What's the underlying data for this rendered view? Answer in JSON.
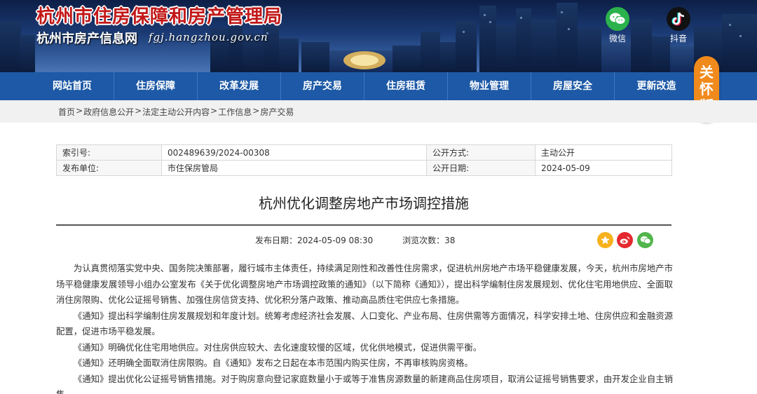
{
  "header": {
    "title": "杭州市住房保障和房产管理局",
    "subtitle": "杭州市房产信息网",
    "url": "fgj.hangzhou.gov.cn",
    "social": [
      {
        "label": "微信",
        "icon": "wechat-icon"
      },
      {
        "label": "抖音",
        "icon": "douyin-icon"
      }
    ]
  },
  "nav": {
    "items": [
      "网站首页",
      "住房保障",
      "改革发展",
      "房产交易",
      "住房租赁",
      "物业管理",
      "房屋安全",
      "更新改造"
    ]
  },
  "care_mode": {
    "chars": [
      "关",
      "怀",
      "版"
    ]
  },
  "breadcrumb": [
    "首页",
    "政府信息公开",
    "法定主动公开内容",
    "工作信息",
    "房产交易"
  ],
  "meta": {
    "index_label": "索引号:",
    "index_value": "002489639/2024-00308",
    "method_label": "公开方式:",
    "method_value": "主动公开",
    "unit_label": "发布单位:",
    "unit_value": "市住保房管局",
    "date_label": "公开日期:",
    "date_value": "2024-05-09"
  },
  "article": {
    "title": "杭州优化调整房地产市场调控措施",
    "publish": "发布日期：2024-05-09 08:30",
    "views": "浏览次数：38",
    "paragraphs": [
      "为认真贯彻落实党中央、国务院决策部署，履行城市主体责任，持续满足刚性和改善性住房需求，促进杭州房地产市场平稳健康发展，今天，杭州市房地产市场平稳健康发展领导小组办公室发布《关于优化调整房地产市场调控政策的通知》（以下简称《通知》），提出科学编制住房发展规划、优化住宅用地供应、全面取消住房限购、优化公证摇号销售、加强住房信贷支持、优化积分落户政策、推动高品质住宅供应七条措施。",
      "《通知》提出科学编制住房发展规划和年度计划。统筹考虑经济社会发展、人口变化、产业布局、住房供需等方面情况，科学安排土地、住房供应和金融资源配置，促进市场平稳发展。",
      "《通知》明确优化住宅用地供应。对住房供应较大、去化速度较慢的区域，优化供地模式，促进供需平衡。",
      "《通知》还明确全面取消住房限购。自《通知》发布之日起在本市范围内购买住房，不再审核购房资格。",
      "《通知》提出优化公证摇号销售措施。对于购房意向登记家庭数量小于或等于准售房源数量的新建商品住房项目，取消公证摇号销售要求，由开发企业自主销售。"
    ]
  },
  "colors": {
    "nav_bg": "#1d59a6",
    "title_red": "#c21818",
    "care_orange": "#f08a1c"
  }
}
